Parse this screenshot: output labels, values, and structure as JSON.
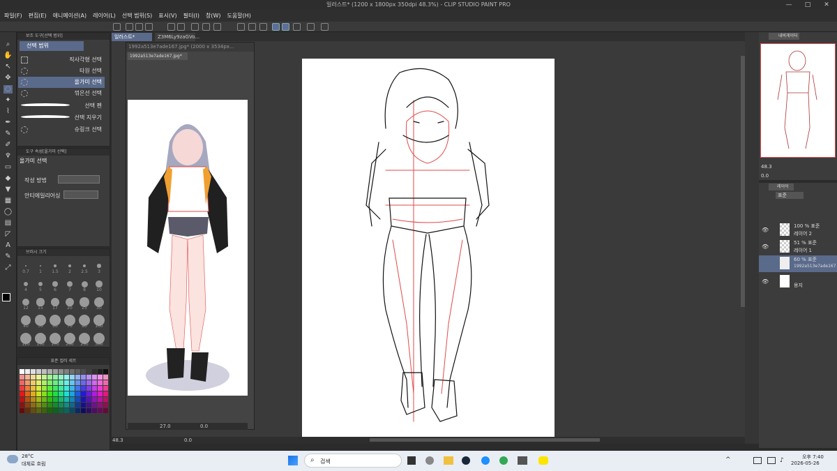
{
  "titlebar": {
    "title": "일러스트* (1200 x 1800px 350dpi 48.3%)  - CLIP STUDIO PAINT PRO",
    "minimize": "—",
    "maximize": "□",
    "close": "✕"
  },
  "menu": [
    "파일(F)",
    "편집(E)",
    "애니메이션(A)",
    "레이어(L)",
    "선택 범위(S)",
    "표시(V)",
    "필터(I)",
    "창(W)",
    "도움말(H)"
  ],
  "subtool_panel": {
    "header": "보조 도구[선택 범위]",
    "group_label": "선택 범위",
    "items": [
      "직사각형 선택",
      "타원 선택",
      "올가미 선택",
      "꺾은선 선택",
      "선택 펜",
      "선택 지우기",
      "슈링크 선택"
    ],
    "selected_index": 2
  },
  "tool_property": {
    "header": "도구 속성[올가미 선택]",
    "title": "올가미 선택",
    "row1_label": "작성 방법",
    "row2_label": "안티에일리어싱"
  },
  "brush_size": {
    "header": "브러시 크기",
    "sizes": [
      "0.7",
      "1",
      "1.5",
      "2",
      "2.5",
      "3",
      "4",
      "5",
      "6",
      "7",
      "8",
      "10",
      "12",
      "15",
      "17",
      "20",
      "25",
      "30",
      "40",
      "50",
      "60",
      "70",
      "80",
      "100",
      "120",
      "150",
      "170",
      "200",
      "250",
      "300"
    ]
  },
  "color_set": {
    "header": "표준 컬러 세트"
  },
  "tabs": [
    {
      "label": "일러스트*"
    },
    {
      "label": "Z3M6Ly9zaGVo..."
    }
  ],
  "subwindow": {
    "title": "1992a513e7ade167.jpg* (2000 x 3534px...",
    "tab": "1992a513e7ade167.jpg*",
    "zoom": "27.0",
    "angle": "0.0"
  },
  "main_status": {
    "zoom": "48.3",
    "angle": "0.0"
  },
  "navigator": {
    "tab": "내비게이터",
    "zoom": "48.3",
    "angle": "0.0"
  },
  "layers": {
    "tab": "레이어",
    "blend": "표준",
    "rows": [
      {
        "opacity": "100 % 표준",
        "name": "레이어 2"
      },
      {
        "opacity": "51 % 표준",
        "name": "레이어 1"
      },
      {
        "opacity": "60 % 표준",
        "name": "1992a513e7ade167"
      },
      {
        "opacity": "",
        "name": "용지"
      }
    ],
    "selected_index": 2
  },
  "taskbar": {
    "temp": "28°C",
    "weather": "대체로 흐림",
    "search": "검색",
    "time": "오후 7:40",
    "date": "2026-05-26"
  },
  "colors": {
    "accent": "#5a6a8a",
    "lineart_red": "#e04a4a",
    "black": "#111111",
    "white": "#ffffff"
  }
}
